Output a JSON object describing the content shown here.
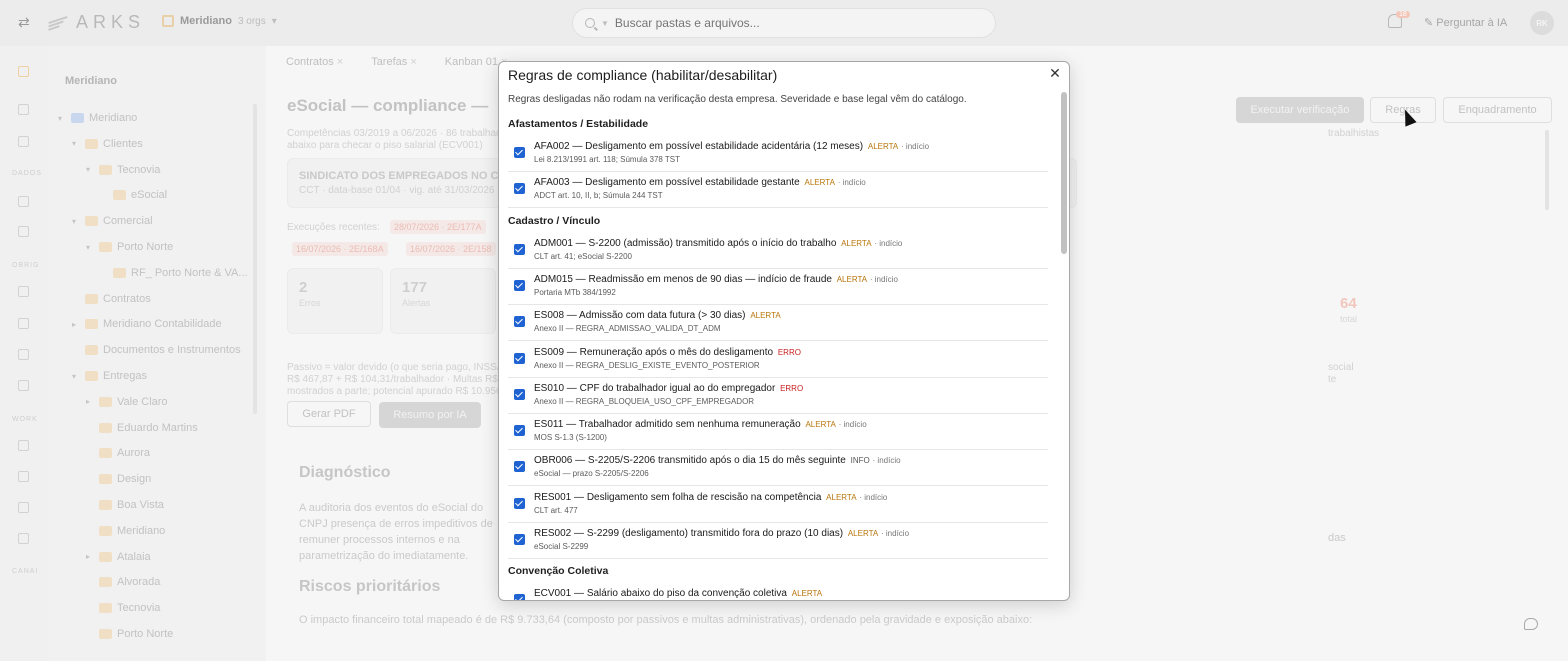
{
  "topbar": {
    "brand": "ARKS",
    "org_name": "Meridiano",
    "org_count": "3 orgs",
    "search_placeholder": "Buscar pastas e arquivos...",
    "notif_count": "18",
    "ask_ai": "Perguntar à IA",
    "avatar_initials": "RK"
  },
  "rail": {
    "labels": [
      "DADOS",
      "OBRIG",
      "WORK",
      "CANAI"
    ]
  },
  "tree": {
    "title": "Meridiano",
    "nodes": [
      {
        "label": "Meridiano",
        "indent": 0,
        "chev": "v"
      },
      {
        "label": "Clientes",
        "indent": 1,
        "chev": "v"
      },
      {
        "label": "Tecnovia",
        "indent": 2,
        "chev": "v"
      },
      {
        "label": "eSocial",
        "indent": 3,
        "chev": ""
      },
      {
        "label": "Comercial",
        "indent": 1,
        "chev": "v"
      },
      {
        "label": "Porto Norte",
        "indent": 2,
        "chev": "v"
      },
      {
        "label": "RF_ Porto Norte & VA...",
        "indent": 3,
        "chev": ""
      },
      {
        "label": "Contratos",
        "indent": 1,
        "chev": ""
      },
      {
        "label": "Meridiano Contabilidade",
        "indent": 1,
        "chev": ">"
      },
      {
        "label": "Documentos e Instrumentos",
        "indent": 1,
        "chev": ""
      },
      {
        "label": "Entregas",
        "indent": 1,
        "chev": "v"
      },
      {
        "label": "Vale Claro",
        "indent": 2,
        "chev": ">"
      },
      {
        "label": "Eduardo Martins",
        "indent": 2,
        "chev": ""
      },
      {
        "label": "Aurora",
        "indent": 2,
        "chev": ""
      },
      {
        "label": "Design",
        "indent": 2,
        "chev": ""
      },
      {
        "label": "Boa Vista",
        "indent": 2,
        "chev": ""
      },
      {
        "label": "Meridiano",
        "indent": 2,
        "chev": ""
      },
      {
        "label": "Atalaia",
        "indent": 2,
        "chev": ">"
      },
      {
        "label": "Alvorada",
        "indent": 2,
        "chev": ""
      },
      {
        "label": "Tecnovia",
        "indent": 2,
        "chev": ""
      },
      {
        "label": "Porto Norte",
        "indent": 2,
        "chev": ""
      }
    ]
  },
  "main": {
    "tabs": [
      "Contratos",
      "Tarefas",
      "Kanban 01"
    ],
    "tab_last": "eSocial — compliance",
    "page_title": "eSocial — compliance —",
    "competencia": "Competências 03/2019 a 06/2026 · 86 trabalhadores",
    "competencia2": "abaixo para checar o piso salarial (ECV001)",
    "right_note": "trabalhistas",
    "sindicato": "SINDICATO DOS EMPREGADOS NO CO",
    "sindicato_sub": "CCT · data-base 01/04 · vig. até 31/03/2026",
    "exec_label": "Execuções recentes:",
    "exec_chips": [
      "28/07/2026 · 2E/177A",
      "16/07/2026 · 2E/168A",
      "16/07/2026 · 2E/158"
    ],
    "stats": [
      {
        "num": "2",
        "label": "Erros"
      },
      {
        "num": "177",
        "label": "Alertas"
      }
    ],
    "right_stat": "64",
    "right_stat_label": "total",
    "passivo": "Passivo = valor devido (o que seria pago, INSS/FGTS/...)",
    "passivo2": "R$ 467,87 + R$ 104,31/trabalhador · Multas R$ 44,47",
    "passivo3": "mostrados a parte; potencial apurado R$ 10.956",
    "passivo_right": "social",
    "passivo_right2": "te",
    "btn_pdf": "Gerar PDF",
    "btn_resumo": "Resumo por IA",
    "btn_executar": "Executar verificação",
    "btn_regras": "Regras",
    "btn_enquadramento": "Enquadramento",
    "diag_title": "Diagnóstico",
    "diag_text": "A auditoria dos eventos do eSocial do CNPJ presença de erros impeditivos de remuner processos internos e na parametrização do imediatamente.",
    "diag_right": "das",
    "riscos_title": "Riscos prioritários",
    "riscos_text": "O impacto financeiro total mapeado é de R$ 9.733,64 (composto por passivos e multas administrativas), ordenado pela gravidade e exposição abaixo:"
  },
  "modal": {
    "title": "Regras de compliance (habilitar/desabilitar)",
    "intro": "Regras desligadas não rodam na verificação desta empresa. Severidade e base legal vêm do catálogo.",
    "sections": [
      {
        "title": "Afastamentos / Estabilidade",
        "rules": [
          {
            "code": "AFA002",
            "text": "Desligamento em possível estabilidade acidentária (12 meses)",
            "severity": "ALERTA",
            "indicio": "· indício",
            "legal": "Lei 8.213/1991 art. 118; Súmula 378 TST",
            "checked": true
          },
          {
            "code": "AFA003",
            "text": "Desligamento em possível estabilidade gestante",
            "severity": "ALERTA",
            "indicio": "· indício",
            "legal": "ADCT art. 10, II, b; Súmula 244 TST",
            "checked": true
          }
        ]
      },
      {
        "title": "Cadastro / Vínculo",
        "rules": [
          {
            "code": "ADM001",
            "text": "S-2200 (admissão) transmitido após o início do trabalho",
            "severity": "ALERTA",
            "indicio": "· indício",
            "legal": "CLT art. 41; eSocial S-2200",
            "checked": true
          },
          {
            "code": "ADM015",
            "text": "Readmissão em menos de 90 dias — indício de fraude",
            "severity": "ALERTA",
            "indicio": "· indício",
            "legal": "Portaria MTb 384/1992",
            "checked": true
          },
          {
            "code": "ES008",
            "text": "Admissão com data futura (> 30 dias)",
            "severity": "ALERTA",
            "indicio": "",
            "legal": "Anexo II — REGRA_ADMISSAO_VALIDA_DT_ADM",
            "checked": true
          },
          {
            "code": "ES009",
            "text": "Remuneração após o mês do desligamento",
            "severity": "ERRO",
            "indicio": "",
            "legal": "Anexo II — REGRA_DESLIG_EXISTE_EVENTO_POSTERIOR",
            "checked": true
          },
          {
            "code": "ES010",
            "text": "CPF do trabalhador igual ao do empregador",
            "severity": "ERRO",
            "indicio": "",
            "legal": "Anexo II — REGRA_BLOQUEIA_USO_CPF_EMPREGADOR",
            "checked": true
          },
          {
            "code": "ES011",
            "text": "Trabalhador admitido sem nenhuma remuneração",
            "severity": "ALERTA",
            "indicio": "· indício",
            "legal": "MOS S-1.3 (S-1200)",
            "checked": true
          },
          {
            "code": "OBR006",
            "text": "S-2205/S-2206 transmitido após o dia 15 do mês seguinte",
            "severity": "INFO",
            "indicio": "· indício",
            "legal": "eSocial — prazo S-2205/S-2206",
            "checked": true
          },
          {
            "code": "RES001",
            "text": "Desligamento sem folha de rescisão na competência",
            "severity": "ALERTA",
            "indicio": "· indício",
            "legal": "CLT art. 477",
            "checked": true
          },
          {
            "code": "RES002",
            "text": "S-2299 (desligamento) transmitido fora do prazo (10 dias)",
            "severity": "ALERTA",
            "indicio": "· indício",
            "legal": "eSocial S-2299",
            "checked": true
          }
        ]
      },
      {
        "title": "Convenção Coletiva",
        "rules": [
          {
            "code": "ECV001",
            "text": "Salário abaixo do piso da convenção coletiva",
            "severity": "ALERTA",
            "indicio": "",
            "legal": "",
            "checked": true
          }
        ]
      }
    ]
  }
}
